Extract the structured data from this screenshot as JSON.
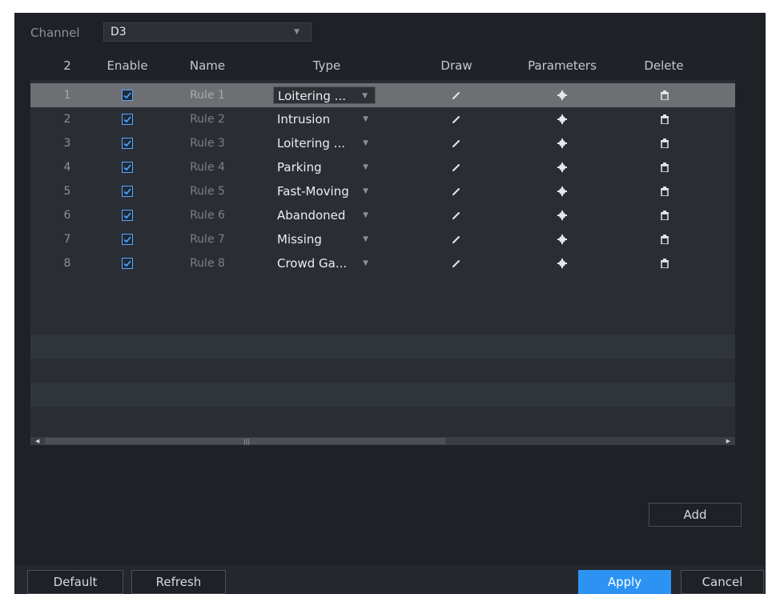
{
  "channel": {
    "label": "Channel",
    "value": "D3"
  },
  "table": {
    "headers": {
      "index": "2",
      "enable": "Enable",
      "name": "Name",
      "type": "Type",
      "draw": "Draw",
      "parameters": "Parameters",
      "delete": "Delete"
    },
    "rows": [
      {
        "index": "1",
        "enabled": true,
        "name": "Rule 1",
        "type": "Loitering ...",
        "selected": true
      },
      {
        "index": "2",
        "enabled": true,
        "name": "Rule 2",
        "type": "Intrusion",
        "selected": false
      },
      {
        "index": "3",
        "enabled": true,
        "name": "Rule 3",
        "type": "Loitering ...",
        "selected": false
      },
      {
        "index": "4",
        "enabled": true,
        "name": "Rule 4",
        "type": "Parking",
        "selected": false
      },
      {
        "index": "5",
        "enabled": true,
        "name": "Rule 5",
        "type": "Fast-Moving",
        "selected": false
      },
      {
        "index": "6",
        "enabled": true,
        "name": "Rule 6",
        "type": "Abandoned",
        "selected": false
      },
      {
        "index": "7",
        "enabled": true,
        "name": "Rule 7",
        "type": "Missing",
        "selected": false
      },
      {
        "index": "8",
        "enabled": true,
        "name": "Rule 8",
        "type": "Crowd Ga...",
        "selected": false
      }
    ]
  },
  "icons": {
    "draw": "pencil-icon",
    "parameters": "gear-icon",
    "delete": "trash-icon",
    "dropdown": "chevron-down-icon"
  },
  "buttons": {
    "add": "Add",
    "default": "Default",
    "refresh": "Refresh",
    "apply": "Apply",
    "cancel": "Cancel"
  },
  "colors": {
    "accent": "#2c93f3",
    "checkbox": "#5aa7ff",
    "panel": "#1e2126"
  }
}
